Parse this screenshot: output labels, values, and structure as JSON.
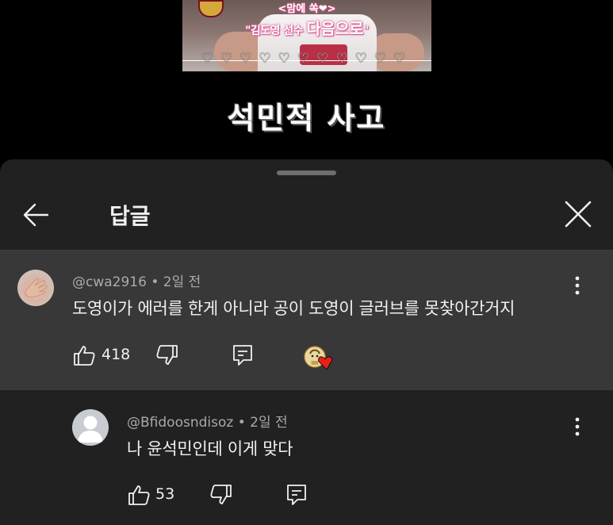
{
  "video": {
    "caption_top": "<맘에 쏙❤>",
    "caption_main_prefix": "\"김도영 선수 ",
    "caption_main_big": "다음으로",
    "caption_main_suffix": "\"",
    "hearts": "♡♡♡♡♡♡♡♡♡♡♡",
    "title": "석민적 사고"
  },
  "sheet": {
    "back_icon": "arrow-left-icon",
    "title": "답글",
    "close_icon": "close-icon"
  },
  "parent_comment": {
    "author": "@cwa2916",
    "time": "2일 전",
    "text": "도영이가 에러를 한게 아니라 공이 도영이 글러브를 못찾아간거지",
    "likes": "418",
    "creator_heart": true,
    "heart_color": "#e62117"
  },
  "reply": {
    "author": "@Bfidoosndisoz",
    "time": "2일 전",
    "text": "나 윤석민인데 이게 맞다",
    "likes": "53"
  },
  "separator": " • ",
  "colors": {
    "background": "#000000",
    "sheet": "#212121",
    "highlighted_comment": "#383838",
    "text_primary": "#f1f1f1",
    "text_secondary": "#aaaaaa"
  }
}
